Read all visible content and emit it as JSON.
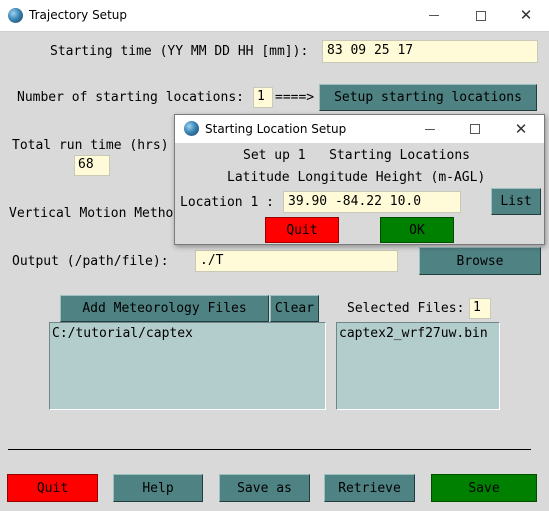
{
  "window": {
    "title": "Trajectory Setup",
    "controls": {
      "minimize": "minimize-icon",
      "maximize": "maximize-icon",
      "close": "close-icon"
    }
  },
  "form": {
    "starting_time_label": "Starting time (YY MM DD HH [mm]):",
    "starting_time_value": "83 09 25 17",
    "num_locations_label": "Number of starting locations:",
    "num_locations_value": "1",
    "arrow": "====>",
    "setup_locations_button": "Setup starting locations",
    "run_time_label": "Total run time (hrs)",
    "run_time_value": "68",
    "vertical_motion_label": "Vertical Motion Metho",
    "output_label": "Output (/path/file):",
    "output_value": "./T",
    "browse_button": "Browse"
  },
  "met": {
    "add_button": "Add Meteorology Files",
    "clear_button": "Clear",
    "selected_label": "Selected Files:",
    "selected_count": "1",
    "directories": [
      "C:/tutorial/captex"
    ],
    "files": [
      "captex2_wrf27uw.bin"
    ]
  },
  "bottom_buttons": {
    "quit": "Quit",
    "help": "Help",
    "save_as": "Save as",
    "retrieve": "Retrieve",
    "save": "Save"
  },
  "dialog": {
    "title": "Starting Location Setup",
    "heading_line1": "Set up 1   Starting Locations",
    "heading_line2": "Latitude Longitude Height (m-AGL)",
    "location_label": "Location 1 :",
    "location_value": "39.90 -84.22 10.0",
    "list_button": "List",
    "quit_button": "Quit",
    "ok_button": "OK"
  },
  "colors": {
    "background": "#d9d9d9",
    "button_teal": "#4f8283",
    "entry_bg": "#fffbd8",
    "listbox_bg": "#b3cdcc",
    "quit_red": "#ff0000",
    "save_green": "#008000"
  }
}
